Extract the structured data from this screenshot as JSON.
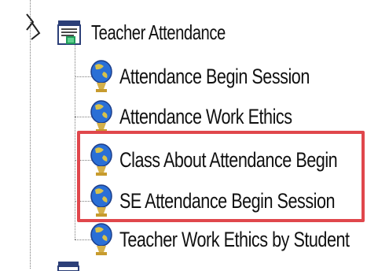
{
  "tree": {
    "parent": {
      "label": "Teacher Attendance",
      "icon": "report-folder-icon"
    },
    "children": [
      {
        "label": "Attendance Begin Session",
        "icon": "globe-icon"
      },
      {
        "label": "Attendance Work Ethics",
        "icon": "globe-icon"
      },
      {
        "label": "Class About Attendance Begin",
        "icon": "globe-icon"
      },
      {
        "label": "SE Attendance Begin Session",
        "icon": "globe-icon"
      },
      {
        "label": "Teacher Work Ethics by Student",
        "icon": "globe-icon"
      }
    ],
    "highlighted_items": [
      "Class About Attendance Begin",
      "SE Attendance Begin Session"
    ]
  },
  "colors": {
    "highlight_border": "#e0474c",
    "globe_blue": "#2a6fd6",
    "globe_yellow": "#d8c24a",
    "tree_line": "#7a7a7a"
  }
}
